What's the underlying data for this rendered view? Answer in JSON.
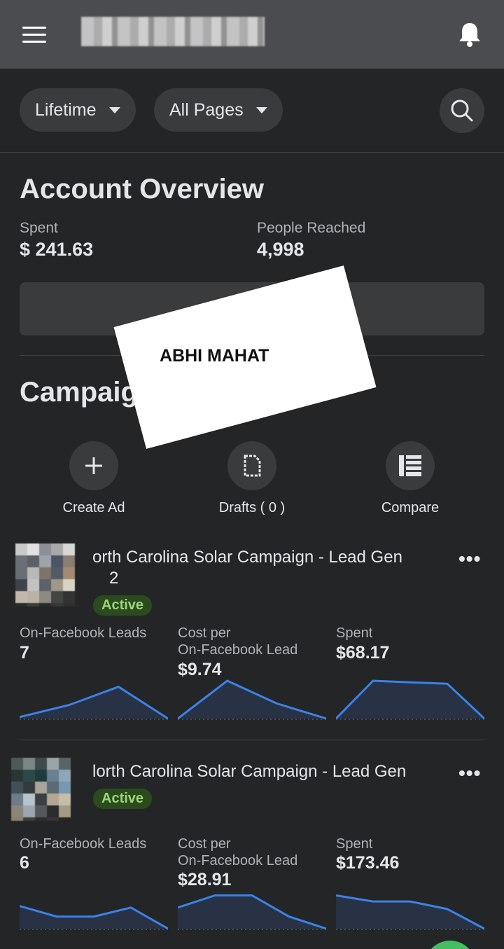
{
  "header": {
    "menu_icon": "hamburger-icon",
    "notifications_icon": "bell-icon"
  },
  "filters": {
    "date_range": "Lifetime",
    "pages": "All Pages",
    "search_icon": "search-icon"
  },
  "overview": {
    "title": "Account Overview",
    "spent_label": "Spent",
    "spent_value": "$ 241.63",
    "reached_label": "People Reached",
    "reached_value": "4,998"
  },
  "overlay_note": "ABHI MAHAT",
  "campaigns_section": {
    "title": "Campaig",
    "actions": [
      {
        "label": "Create Ad",
        "icon": "plus-icon"
      },
      {
        "label": "Drafts ( 0 )",
        "icon": "draft-document-icon"
      },
      {
        "label": "Compare",
        "icon": "compare-table-icon"
      }
    ]
  },
  "campaigns": [
    {
      "name_line1": "orth Carolina Solar Campaign - Lead Gen",
      "name_line2": "2",
      "status": "Active",
      "stats": [
        {
          "label": "On-Facebook Leads",
          "value": "7",
          "trend": [
            0.2,
            1.8,
            4.2,
            0
          ]
        },
        {
          "label": "Cost per\nOn-Facebook Lead",
          "value": "$9.74",
          "trend": [
            0,
            5,
            2,
            0
          ]
        },
        {
          "label": "Spent",
          "value": "$68.17",
          "trend": [
            0,
            5,
            4.8,
            4.6,
            0
          ]
        }
      ]
    },
    {
      "name_line1": "lorth Carolina Solar Campaign - Lead Gen",
      "status": "Active",
      "stats": [
        {
          "label": "On-Facebook Leads",
          "value": "6",
          "trend": [
            3,
            1.6,
            1.6,
            2.8,
            0
          ]
        },
        {
          "label": "Cost per\nOn-Facebook Lead",
          "value": "$28.91",
          "trend": [
            2.8,
            4.4,
            4.4,
            1.6,
            0
          ]
        },
        {
          "label": "Spent",
          "value": "$173.46",
          "trend": [
            4.4,
            3.6,
            3.6,
            2.6,
            0
          ]
        }
      ]
    }
  ],
  "colors": {
    "accent_line": "#3b82e8",
    "active_badge_text": "#9ad67a",
    "background": "#242526"
  }
}
